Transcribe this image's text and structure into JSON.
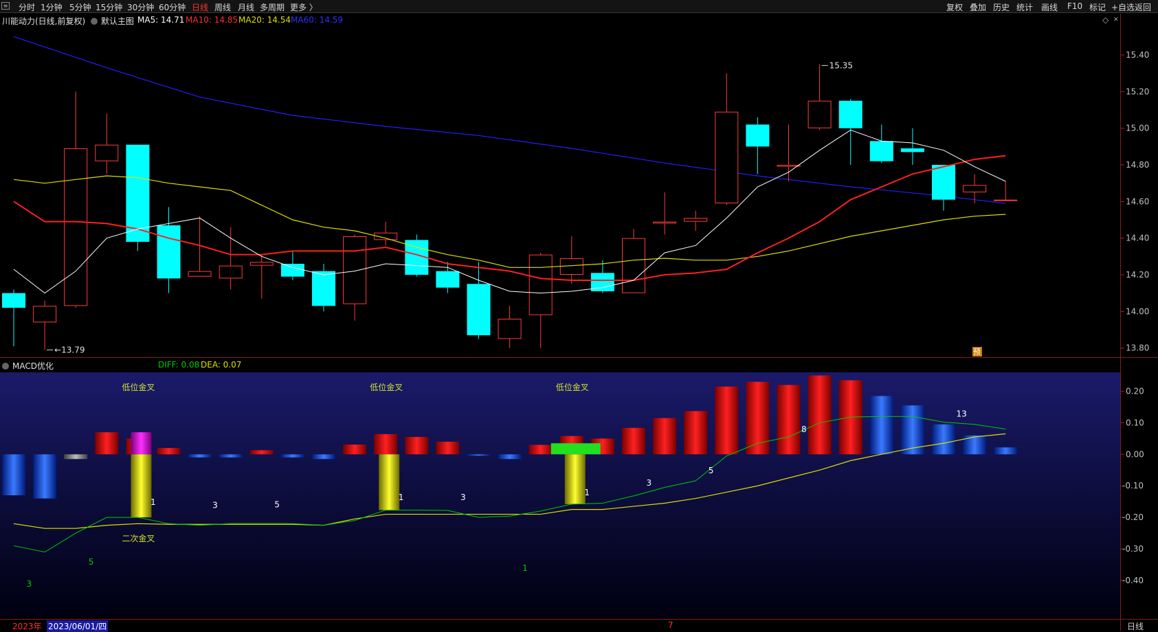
{
  "toolbar": {
    "periods": [
      "分时",
      "1分钟",
      "5分钟",
      "15分钟",
      "30分钟",
      "60分钟",
      "日线",
      "周线",
      "月线",
      "多周期",
      "更多 〉"
    ],
    "active_period": "日线",
    "right_items": [
      "复权",
      "叠加",
      "历史",
      "统计",
      "画线",
      "F10",
      "标记",
      "+自选",
      "返回"
    ]
  },
  "main_info": {
    "stock_name": "川能动力(日线,前复权)",
    "template_label": "默认主图",
    "ma5": "MA5: 14.71",
    "ma10": "MA10: 14.85",
    "ma20": "MA20: 14.54",
    "ma60": "MA60: 14.59"
  },
  "macd_info": {
    "name": "MACD优化",
    "diff": "DIFF: 0.08",
    "dea": "DEA: 0.07"
  },
  "colors": {
    "up": "#ff3b3b",
    "down": "#00ffff",
    "ma5": "#ffffff",
    "ma10": "#ff2020",
    "ma20": "#e0e000",
    "ma60": "#2020ff",
    "diff": "#00cc00",
    "dea": "#e0e000",
    "macd_bg_top": "#1a1a6a",
    "macd_bg_bottom": "#000010"
  },
  "chart_data": [
    {
      "type": "candlestick",
      "title": "川能动力(日线,前复权)",
      "ylim": [
        13.75,
        15.55
      ],
      "yticks": [
        13.8,
        14.0,
        14.2,
        14.4,
        14.6,
        14.8,
        15.0,
        15.2,
        15.4
      ],
      "ytick_labels": [
        "13.80",
        "14.00",
        "14.20",
        "14.40",
        "14.60",
        "14.80",
        "15.00",
        "15.20",
        "15.40"
      ],
      "candles": [
        {
          "o": 14.1,
          "h": 14.12,
          "l": 13.81,
          "c": 14.02
        },
        {
          "o": 13.94,
          "h": 14.06,
          "l": 13.79,
          "c": 14.03
        },
        {
          "o": 14.03,
          "h": 15.2,
          "l": 14.02,
          "c": 14.89
        },
        {
          "o": 14.82,
          "h": 15.08,
          "l": 14.75,
          "c": 14.91
        },
        {
          "o": 14.91,
          "h": 14.91,
          "l": 14.33,
          "c": 14.38
        },
        {
          "o": 14.47,
          "h": 14.57,
          "l": 14.1,
          "c": 14.18
        },
        {
          "o": 14.19,
          "h": 14.52,
          "l": 14.19,
          "c": 14.22
        },
        {
          "o": 14.18,
          "h": 14.46,
          "l": 14.12,
          "c": 14.25
        },
        {
          "o": 14.25,
          "h": 14.31,
          "l": 14.07,
          "c": 14.27
        },
        {
          "o": 14.26,
          "h": 14.33,
          "l": 14.17,
          "c": 14.19
        },
        {
          "o": 14.22,
          "h": 14.26,
          "l": 14.0,
          "c": 14.03
        },
        {
          "o": 14.04,
          "h": 14.42,
          "l": 13.95,
          "c": 14.41
        },
        {
          "o": 14.39,
          "h": 14.49,
          "l": 14.36,
          "c": 14.43
        },
        {
          "o": 14.39,
          "h": 14.42,
          "l": 14.19,
          "c": 14.2
        },
        {
          "o": 14.22,
          "h": 14.27,
          "l": 14.1,
          "c": 14.13
        },
        {
          "o": 14.15,
          "h": 14.27,
          "l": 13.85,
          "c": 13.87
        },
        {
          "o": 13.85,
          "h": 14.03,
          "l": 13.8,
          "c": 13.96
        },
        {
          "o": 13.98,
          "h": 14.32,
          "l": 13.8,
          "c": 14.31
        },
        {
          "o": 14.2,
          "h": 14.41,
          "l": 14.15,
          "c": 14.29
        },
        {
          "o": 14.21,
          "h": 14.28,
          "l": 14.1,
          "c": 14.11
        },
        {
          "o": 14.1,
          "h": 14.45,
          "l": 14.1,
          "c": 14.4
        },
        {
          "o": 14.48,
          "h": 14.65,
          "l": 14.42,
          "c": 14.49
        },
        {
          "o": 14.49,
          "h": 14.55,
          "l": 14.44,
          "c": 14.51
        },
        {
          "o": 14.59,
          "h": 15.3,
          "l": 14.58,
          "c": 15.09
        },
        {
          "o": 15.02,
          "h": 15.06,
          "l": 14.75,
          "c": 14.9
        },
        {
          "o": 14.79,
          "h": 15.02,
          "l": 14.71,
          "c": 14.8
        },
        {
          "o": 15.0,
          "h": 15.35,
          "l": 14.99,
          "c": 15.15
        },
        {
          "o": 15.15,
          "h": 15.16,
          "l": 14.8,
          "c": 15.0
        },
        {
          "o": 14.93,
          "h": 15.02,
          "l": 14.81,
          "c": 14.82
        },
        {
          "o": 14.89,
          "h": 15.0,
          "l": 14.8,
          "c": 14.87
        },
        {
          "o": 14.8,
          "h": 14.8,
          "l": 14.55,
          "c": 14.61
        },
        {
          "o": 14.65,
          "h": 14.75,
          "l": 14.59,
          "c": 14.69
        },
        {
          "o": 14.61,
          "h": 14.71,
          "l": 14.61,
          "c": 14.61
        }
      ],
      "ma5": [
        14.23,
        14.1,
        14.22,
        14.4,
        14.45,
        14.48,
        14.51,
        14.4,
        14.3,
        14.24,
        14.2,
        14.22,
        14.26,
        14.25,
        14.24,
        14.17,
        14.11,
        14.1,
        14.11,
        14.13,
        14.17,
        14.32,
        14.36,
        14.51,
        14.68,
        14.76,
        14.88,
        14.99,
        14.93,
        14.92,
        14.88,
        14.79,
        14.71
      ],
      "ma10": [
        14.6,
        14.49,
        14.49,
        14.48,
        14.45,
        14.4,
        14.36,
        14.31,
        14.31,
        14.33,
        14.33,
        14.33,
        14.35,
        14.31,
        14.26,
        14.24,
        14.22,
        14.18,
        14.17,
        14.17,
        14.17,
        14.2,
        14.21,
        14.23,
        14.32,
        14.4,
        14.49,
        14.61,
        14.68,
        14.75,
        14.79,
        14.83,
        14.85
      ],
      "ma20": [
        14.72,
        14.7,
        14.72,
        14.74,
        14.73,
        14.7,
        14.68,
        14.66,
        14.58,
        14.5,
        14.46,
        14.44,
        14.4,
        14.35,
        14.31,
        14.28,
        14.24,
        14.24,
        14.25,
        14.26,
        14.28,
        14.29,
        14.28,
        14.28,
        14.3,
        14.33,
        14.37,
        14.41,
        14.44,
        14.47,
        14.5,
        14.52,
        14.53
      ],
      "ma60_points": [
        [
          0,
          15.5
        ],
        [
          3,
          15.33
        ],
        [
          6,
          15.17
        ],
        [
          9,
          15.07
        ],
        [
          12,
          15.01
        ],
        [
          15,
          14.96
        ],
        [
          18,
          14.89
        ],
        [
          21,
          14.81
        ],
        [
          24,
          14.74
        ],
        [
          27,
          14.68
        ],
        [
          30,
          14.63
        ],
        [
          32,
          14.59
        ]
      ],
      "annotations": [
        {
          "index": 1,
          "value": 13.79,
          "label": "13.79"
        },
        {
          "index": 26,
          "value": 15.35,
          "label": "15.35"
        }
      ],
      "forecast_marker": "预"
    },
    {
      "type": "bar",
      "title": "MACD优化",
      "ylim": [
        -0.52,
        0.26
      ],
      "yticks": [
        0.2,
        0.1,
        0.0,
        -0.1,
        -0.2,
        -0.3,
        -0.4
      ],
      "ytick_labels": [
        "0.20",
        "0.10",
        "0.00",
        "-0.10",
        "-0.20",
        "-0.30",
        "-0.40"
      ],
      "macd": [
        -0.13,
        -0.14,
        -0.015,
        0.07,
        0.05,
        0.02,
        -0.01,
        -0.01,
        0.013,
        -0.01,
        -0.015,
        0.031,
        0.064,
        0.055,
        0.04,
        -0.003,
        -0.015,
        0.03,
        0.058,
        0.05,
        0.084,
        0.115,
        0.137,
        0.215,
        0.23,
        0.22,
        0.25,
        0.235,
        0.185,
        0.155,
        0.095,
        0.06,
        0.022
      ],
      "diff": [
        -0.29,
        -0.31,
        -0.25,
        -0.2,
        -0.2,
        -0.22,
        -0.225,
        -0.22,
        -0.22,
        -0.22,
        -0.225,
        -0.21,
        -0.177,
        -0.177,
        -0.178,
        -0.2,
        -0.196,
        -0.18,
        -0.158,
        -0.155,
        -0.132,
        -0.105,
        -0.084,
        -0.005,
        0.035,
        0.055,
        0.1,
        0.118,
        0.12,
        0.12,
        0.102,
        0.095,
        0.08
      ],
      "dea": [
        -0.22,
        -0.235,
        -0.235,
        -0.225,
        -0.22,
        -0.222,
        -0.222,
        -0.222,
        -0.222,
        -0.222,
        -0.225,
        -0.205,
        -0.19,
        -0.19,
        -0.19,
        -0.19,
        -0.19,
        -0.19,
        -0.175,
        -0.175,
        -0.165,
        -0.155,
        -0.14,
        -0.12,
        -0.1,
        -0.075,
        -0.05,
        -0.02,
        0.0,
        0.02,
        0.035,
        0.055,
        0.065
      ],
      "golden_cross_labels": [
        {
          "index": 4,
          "text": "低位金叉"
        },
        {
          "index": 12,
          "text": "低位金叉"
        },
        {
          "index": 18,
          "text": "低位金叉"
        }
      ],
      "second_cross": {
        "index": 4,
        "text": "二次金叉"
      },
      "count_labels": [
        {
          "index": 4.5,
          "value": -0.16,
          "text": "1",
          "color": "#ffffff"
        },
        {
          "index": 6.5,
          "value": -0.17,
          "text": "3",
          "color": "#ffffff"
        },
        {
          "index": 8.5,
          "value": -0.168,
          "text": "5",
          "color": "#ffffff"
        },
        {
          "index": 12.5,
          "value": -0.145,
          "text": "1",
          "color": "#ffffff"
        },
        {
          "index": 14.5,
          "value": -0.145,
          "text": "3",
          "color": "#ffffff"
        },
        {
          "index": 18.5,
          "value": -0.13,
          "text": "1",
          "color": "#ffffff"
        },
        {
          "index": 20.5,
          "value": -0.1,
          "text": "3",
          "color": "#ffffff"
        },
        {
          "index": 22.5,
          "value": -0.06,
          "text": "5",
          "color": "#ffffff"
        },
        {
          "index": 25.5,
          "value": 0.07,
          "text": "8",
          "color": "#ffffff"
        },
        {
          "index": 30.5,
          "value": 0.12,
          "text": "13",
          "color": "#ffffff"
        },
        {
          "index": 0.5,
          "value": -0.42,
          "text": "3",
          "color": "#00cc00"
        },
        {
          "index": 2.5,
          "value": -0.35,
          "text": "5",
          "color": "#00cc00"
        },
        {
          "index": 16.5,
          "value": -0.37,
          "text": "1",
          "color": "#00cc00"
        }
      ]
    }
  ],
  "status_bar": {
    "year_label": "2023年",
    "date_label": "2023/06/01/四",
    "month_marker": "7",
    "right_label": "日线"
  }
}
